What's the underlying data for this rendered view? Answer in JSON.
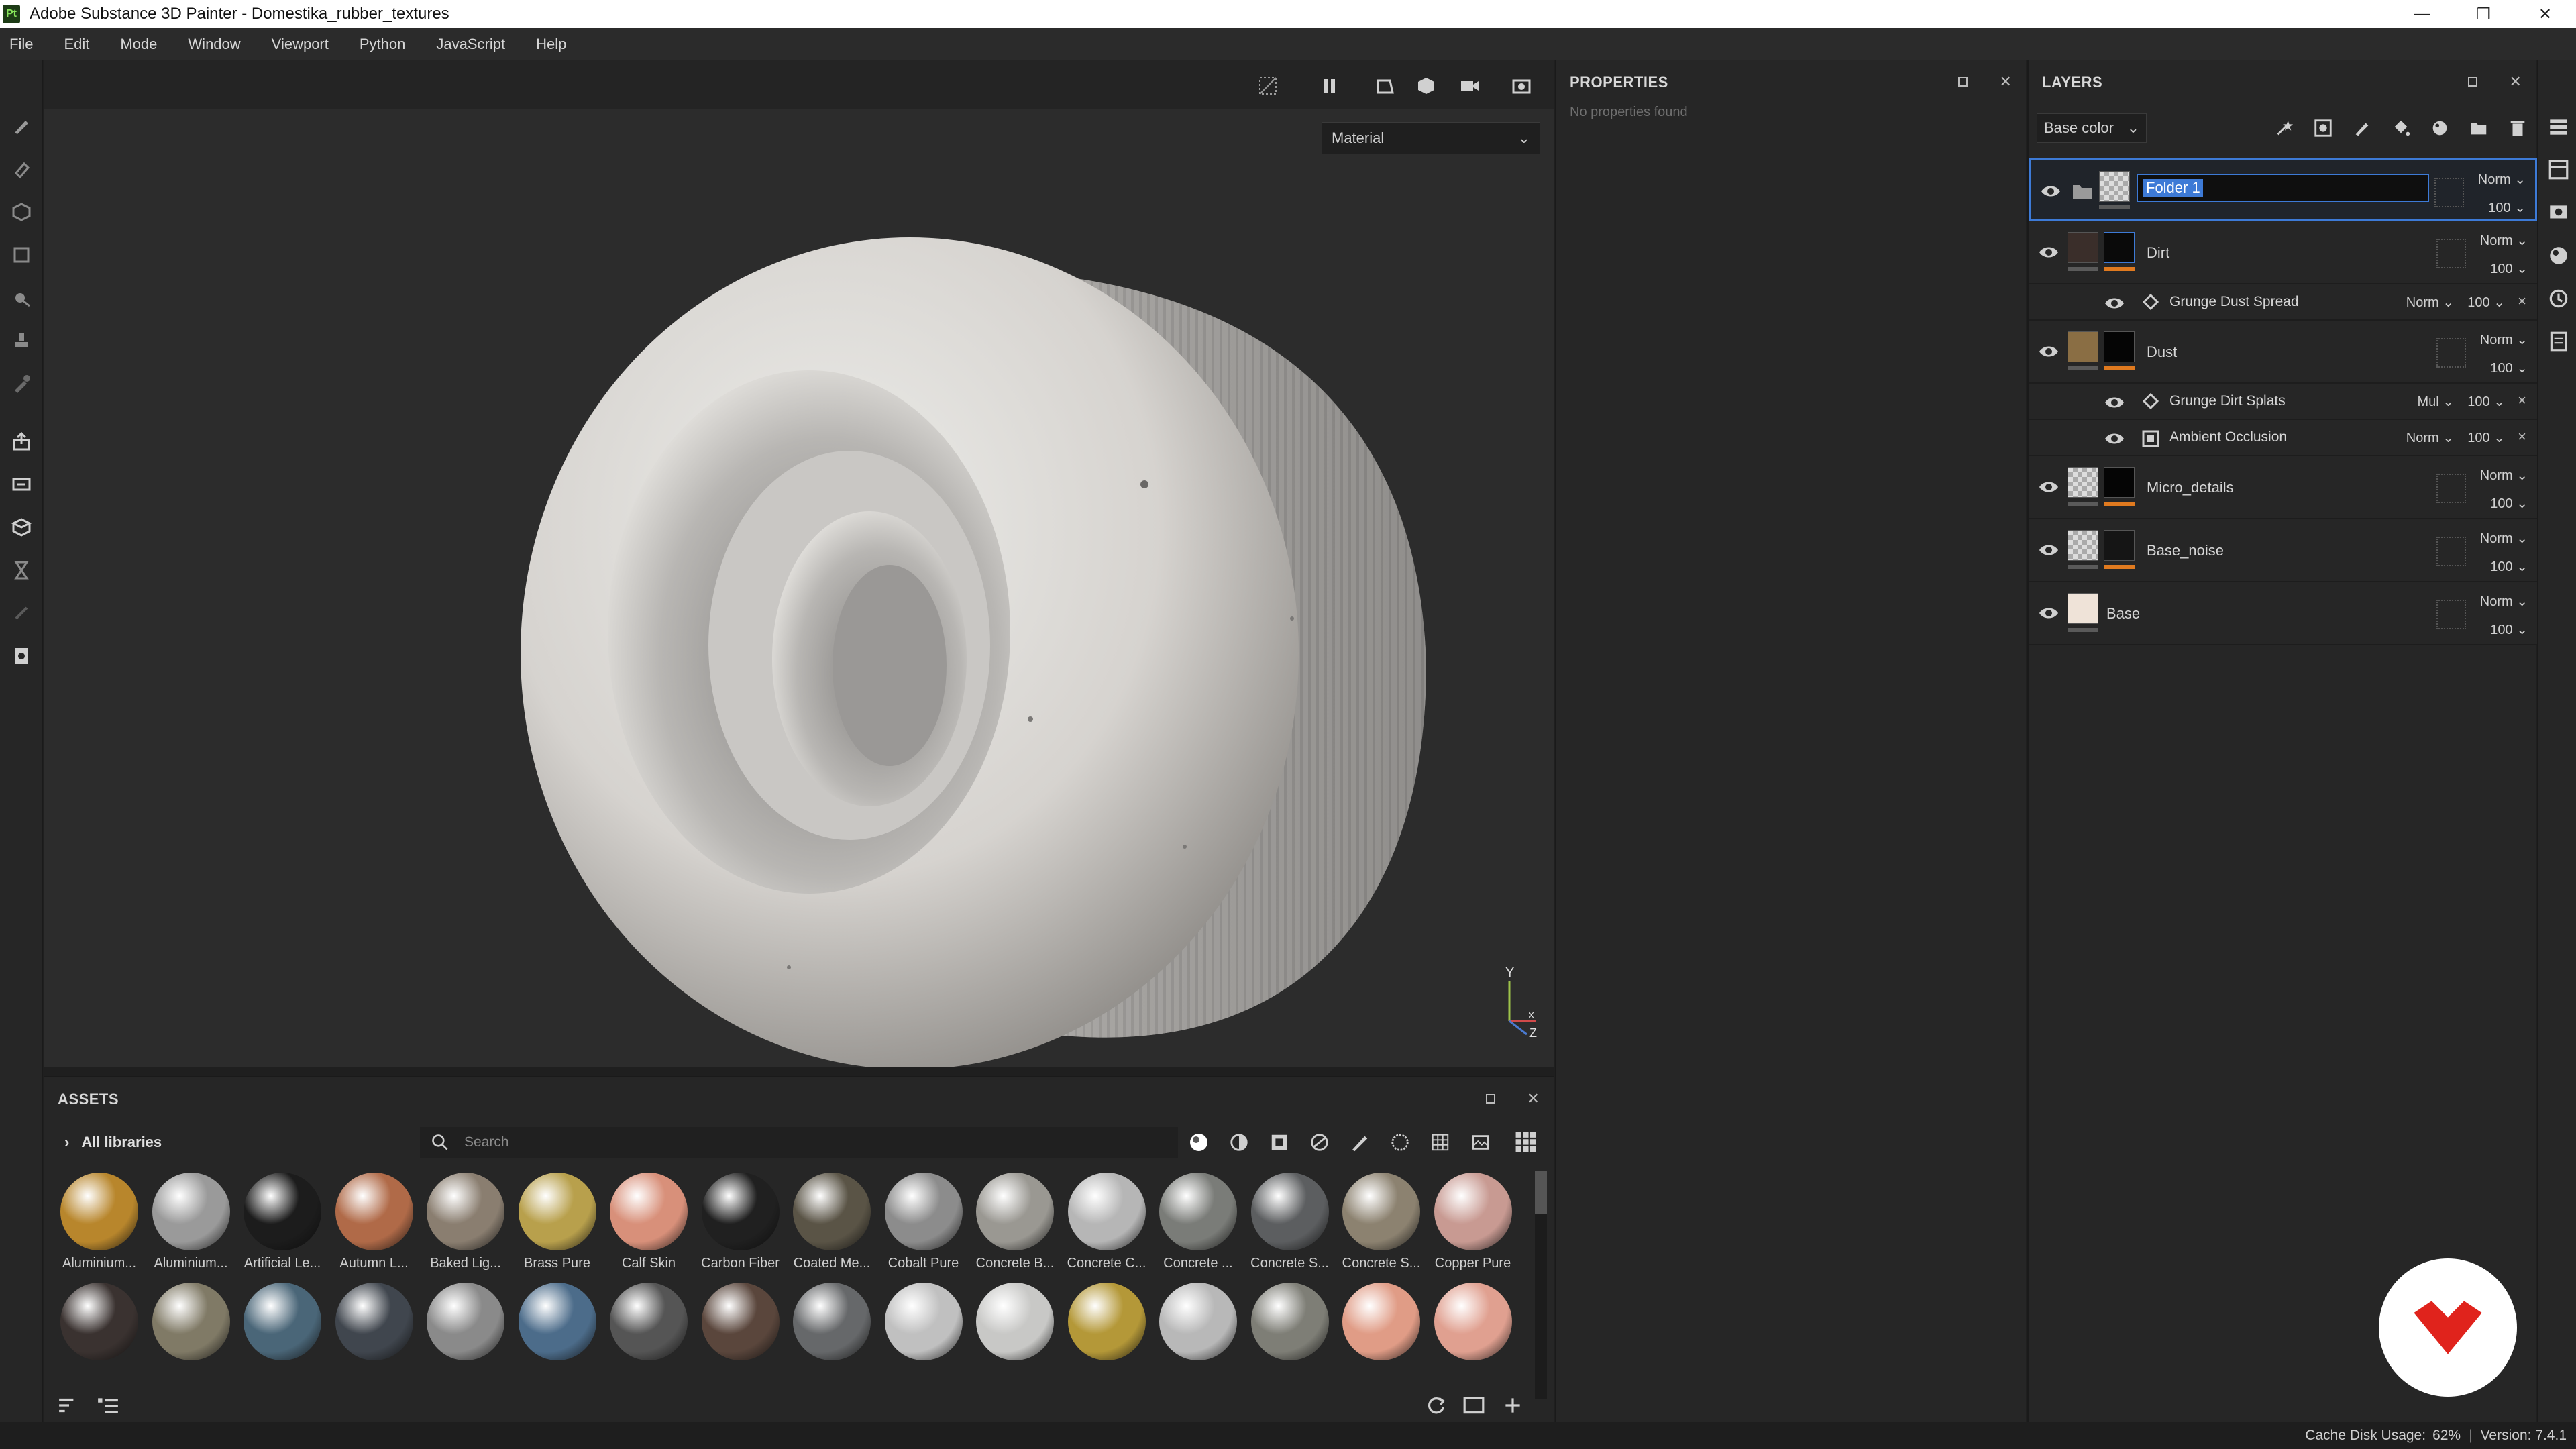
{
  "window": {
    "title": "Adobe Substance 3D Painter - Domestika_rubber_textures",
    "logo_text": "Pt",
    "minimize": "—",
    "maximize": "❐",
    "close": "✕"
  },
  "menu": [
    "File",
    "Edit",
    "Mode",
    "Window",
    "Viewport",
    "Python",
    "JavaScript",
    "Help"
  ],
  "viewport": {
    "material_select": "Material",
    "axis_y": "Y",
    "axis_z": "Z",
    "axis_x": "X"
  },
  "properties": {
    "title": "PROPERTIES",
    "empty_text": "No properties found"
  },
  "layers": {
    "title": "LAYERS",
    "channel": "Base color",
    "items": [
      {
        "name": "Folder 1",
        "blend": "Norm",
        "opacity": "100",
        "type": "folder",
        "selected": true
      },
      {
        "name": "Dirt",
        "blend": "Norm",
        "opacity": "100",
        "type": "fill"
      },
      {
        "name": "Grunge Dust Spread",
        "blend": "Norm",
        "opacity": "100",
        "type": "effect"
      },
      {
        "name": "Dust",
        "blend": "Norm",
        "opacity": "100",
        "type": "fill"
      },
      {
        "name": "Grunge Dirt Splats",
        "blend": "Mul",
        "opacity": "100",
        "type": "effect"
      },
      {
        "name": "Ambient Occlusion",
        "blend": "Norm",
        "opacity": "100",
        "type": "effect"
      },
      {
        "name": "Micro_details",
        "blend": "Norm",
        "opacity": "100",
        "type": "fill"
      },
      {
        "name": "Base_noise",
        "blend": "Norm",
        "opacity": "100",
        "type": "fill"
      },
      {
        "name": "Base",
        "blend": "Norm",
        "opacity": "100",
        "type": "fill"
      }
    ]
  },
  "assets": {
    "title": "ASSETS",
    "library": "All libraries",
    "search_placeholder": "Search",
    "row1": [
      {
        "label": "Aluminium...",
        "color": "#b8862c"
      },
      {
        "label": "Aluminium...",
        "color": "#9a9a9a"
      },
      {
        "label": "Artificial Le...",
        "color": "#1c1c1c"
      },
      {
        "label": "Autumn L...",
        "color": "#b06a48"
      },
      {
        "label": "Baked Lig...",
        "color": "#8a7e70"
      },
      {
        "label": "Brass Pure",
        "color": "#b8a04c"
      },
      {
        "label": "Calf Skin",
        "color": "#d8907a"
      },
      {
        "label": "Carbon Fiber",
        "color": "#202020"
      },
      {
        "label": "Coated Me...",
        "color": "#5a5446"
      },
      {
        "label": "Cobalt Pure",
        "color": "#8c8c8c"
      },
      {
        "label": "Concrete B...",
        "color": "#9a9892"
      },
      {
        "label": "Concrete C...",
        "color": "#b6b6b6"
      },
      {
        "label": "Concrete ...",
        "color": "#7a7c78"
      },
      {
        "label": "Concrete S...",
        "color": "#5c5e60"
      },
      {
        "label": "Concrete S...",
        "color": "#8c8270"
      },
      {
        "label": "Copper Pure",
        "color": "#c89a92"
      }
    ],
    "row2": [
      {
        "color": "#3a3230"
      },
      {
        "color": "#807a66"
      },
      {
        "color": "#4a6678"
      },
      {
        "color": "#40464e"
      },
      {
        "color": "#8a8a8a"
      },
      {
        "color": "#4c6c8a"
      },
      {
        "color": "#555555"
      },
      {
        "color": "#5a463c"
      },
      {
        "color": "#66686a"
      },
      {
        "color": "#c0c0c0"
      },
      {
        "color": "#c8c8c6"
      },
      {
        "color": "#b49838"
      },
      {
        "color": "#b8b8b8"
      },
      {
        "color": "#7e7e76"
      },
      {
        "color": "#e09c86"
      },
      {
        "color": "#e0a090"
      }
    ]
  },
  "status": {
    "cache": "Cache Disk Usage:",
    "cache_value": "62%",
    "version": "Version: 7.4.1"
  },
  "colors": {
    "accent": "#3d7ad6",
    "orange": "#e07a1f",
    "badge_red": "#e0231c"
  }
}
